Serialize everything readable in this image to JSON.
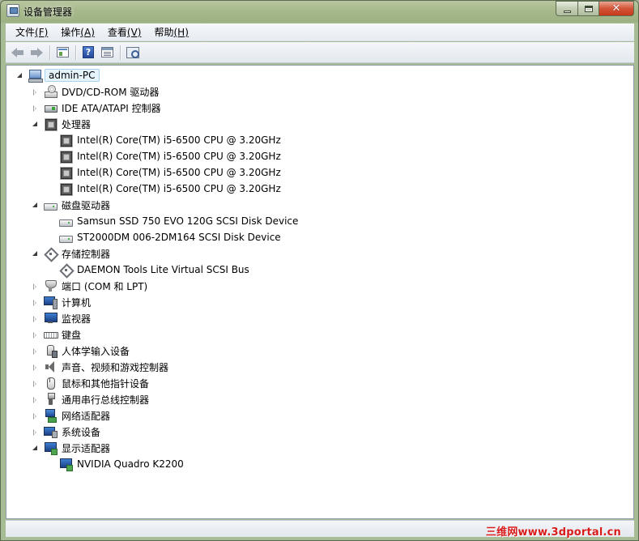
{
  "window": {
    "title": "设备管理器"
  },
  "menu": [
    {
      "label": "文件",
      "mnemonic": "(F)"
    },
    {
      "label": "操作",
      "mnemonic": "(A)"
    },
    {
      "label": "查看",
      "mnemonic": "(V)"
    },
    {
      "label": "帮助",
      "mnemonic": "(H)"
    }
  ],
  "toolbar": {
    "back_icon": "arrow-left-icon",
    "forward_icon": "arrow-right-icon",
    "properties_icon": "properties-icon",
    "help_icon": "help-icon",
    "help_glyph": "?",
    "view_icon": "view-icon",
    "scan_icon": "scan-hardware-icon"
  },
  "tree": {
    "root": "admin-PC",
    "categories": [
      {
        "label": "DVD/CD-ROM 驱动器",
        "icon": "dvd-drive-icon",
        "expanded": false,
        "children": []
      },
      {
        "label": "IDE ATA/ATAPI 控制器",
        "icon": "ide-controller-icon",
        "expanded": false,
        "children": []
      },
      {
        "label": "处理器",
        "icon": "processor-icon",
        "expanded": true,
        "children": [
          "Intel(R) Core(TM) i5-6500 CPU @ 3.20GHz",
          "Intel(R) Core(TM) i5-6500 CPU @ 3.20GHz",
          "Intel(R) Core(TM) i5-6500 CPU @ 3.20GHz",
          "Intel(R) Core(TM) i5-6500 CPU @ 3.20GHz"
        ]
      },
      {
        "label": "磁盘驱动器",
        "icon": "disk-drive-icon",
        "expanded": true,
        "children": [
          "Samsun  SSD 750 EVO 120G SCSI Disk Device",
          "ST2000DM 006-2DM164 SCSI Disk Device"
        ]
      },
      {
        "label": "存储控制器",
        "icon": "storage-controller-icon",
        "expanded": true,
        "children": [
          "DAEMON Tools Lite Virtual SCSI Bus"
        ]
      },
      {
        "label": "端口 (COM 和 LPT)",
        "icon": "port-icon",
        "expanded": false,
        "children": []
      },
      {
        "label": "计算机",
        "icon": "computer-icon",
        "expanded": false,
        "children": []
      },
      {
        "label": "监视器",
        "icon": "monitor-icon",
        "expanded": false,
        "children": []
      },
      {
        "label": "键盘",
        "icon": "keyboard-icon",
        "expanded": false,
        "children": []
      },
      {
        "label": "人体学输入设备",
        "icon": "hid-icon",
        "expanded": false,
        "children": []
      },
      {
        "label": "声音、视频和游戏控制器",
        "icon": "sound-icon",
        "expanded": false,
        "children": []
      },
      {
        "label": "鼠标和其他指针设备",
        "icon": "mouse-icon",
        "expanded": false,
        "children": []
      },
      {
        "label": "通用串行总线控制器",
        "icon": "usb-icon",
        "expanded": false,
        "children": []
      },
      {
        "label": "网络适配器",
        "icon": "network-adapter-icon",
        "expanded": false,
        "children": []
      },
      {
        "label": "系统设备",
        "icon": "system-device-icon",
        "expanded": false,
        "children": []
      },
      {
        "label": "显示适配器",
        "icon": "display-adapter-icon",
        "expanded": true,
        "children": [
          "NVIDIA Quadro K2200"
        ]
      }
    ]
  },
  "watermark": "三维网www.3dportal.cn",
  "colors": {
    "selection_bg": "#e5f3fb",
    "selection_border": "#a6d3ef",
    "watermark": "#d81b1b"
  }
}
